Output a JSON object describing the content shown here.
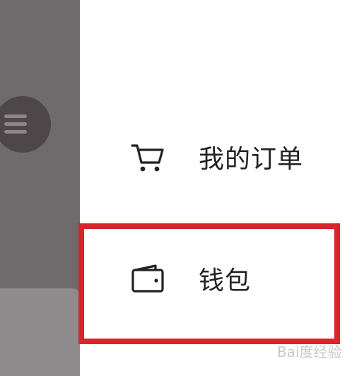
{
  "drawer": {
    "items": [
      {
        "label": "我的订单",
        "icon": "shopping-cart-icon"
      },
      {
        "label": "钱包",
        "icon": "wallet-icon"
      }
    ]
  },
  "overlay": {
    "fab_icon": "hamburger-menu-icon"
  },
  "highlight": {
    "color": "#d8242b"
  },
  "watermark": {
    "text": "Bai度经验"
  }
}
